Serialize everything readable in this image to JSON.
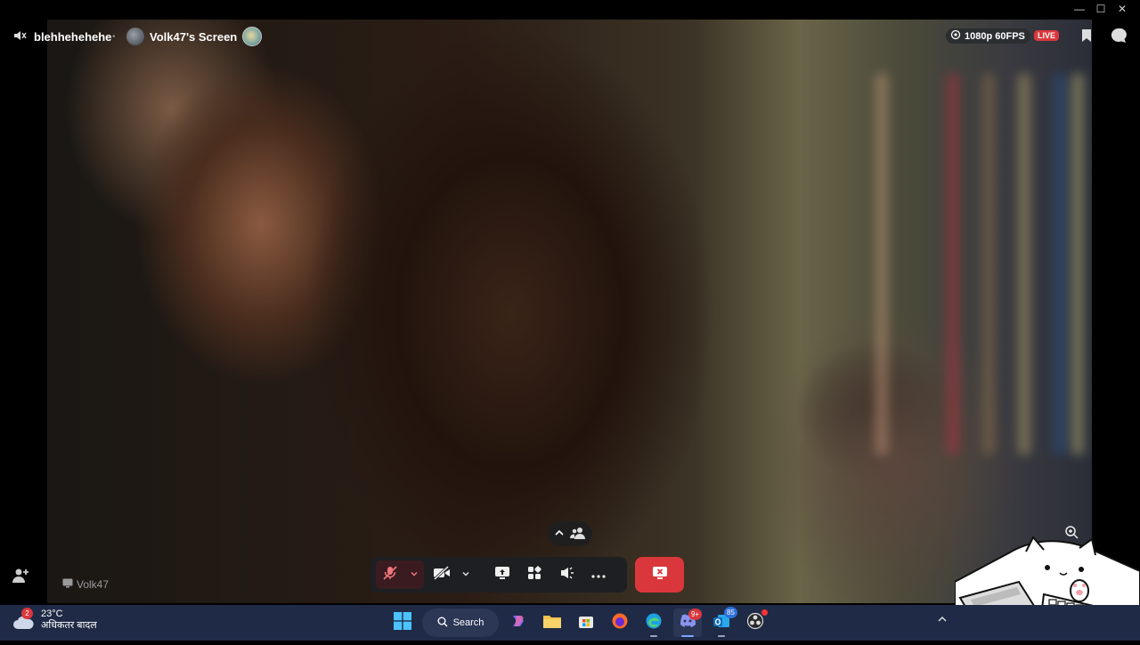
{
  "window": {
    "minimize": "—",
    "maximize": "☐",
    "close": "✕"
  },
  "stream": {
    "user_name": "blehhehehehe",
    "screen_title": "Volk47's Screen",
    "quality": "1080p 60FPS",
    "live_label": "LIVE",
    "participant_name": "Volk47"
  },
  "icons": {
    "mute": "microphone-muted-icon",
    "camera": "camera-off-icon",
    "share": "screen-share-icon",
    "activities": "activities-icon",
    "soundboard": "soundboard-icon",
    "more": "more-options-icon",
    "end": "end-stream-icon"
  },
  "colors": {
    "live": "#da373c",
    "end_call": "#da373c",
    "taskbar": "#1f2a46"
  },
  "taskbar": {
    "weather_temp": "23°C",
    "weather_desc": "अधिकतर बादल",
    "weather_badge": "2",
    "search_label": "Search",
    "discord_badge": "9+",
    "outlook_badge": "85"
  }
}
